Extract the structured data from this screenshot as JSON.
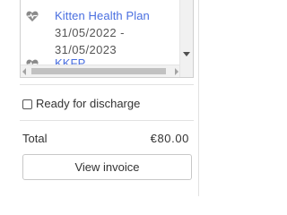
{
  "plans": [
    {
      "icon": "heart-pulse-icon",
      "name": "Kitten Health Plan",
      "date_start": "31/05/2022 -",
      "date_end": "31/05/2023"
    },
    {
      "icon": "heart-pulse-icon",
      "name": "KKFP"
    }
  ],
  "discharge": {
    "label": "Ready for discharge",
    "checked": false
  },
  "total": {
    "label": "Total",
    "value": "€80.00"
  },
  "view_invoice_label": "View invoice",
  "colors": {
    "link": "#4a6fe0",
    "icon": "#8a8a8a",
    "text": "#333333",
    "border": "#c8c8c8"
  }
}
